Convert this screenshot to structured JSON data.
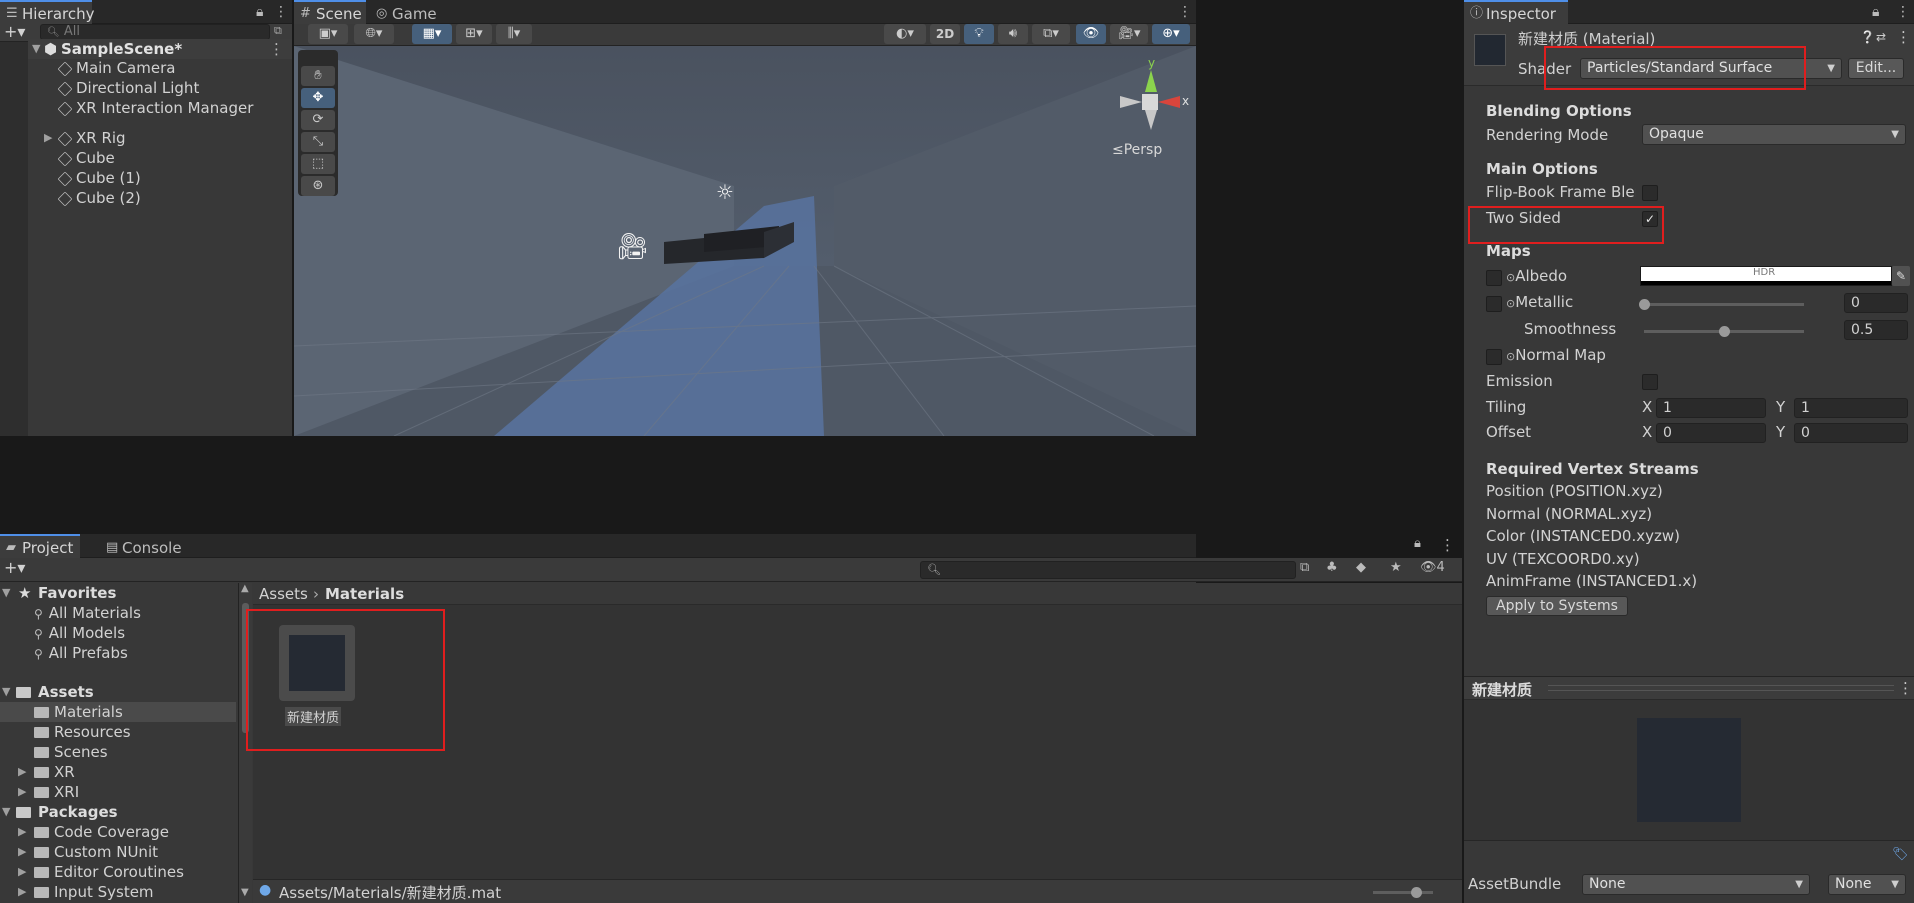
{
  "hierarchy": {
    "tab_label": "Hierarchy",
    "search_placeholder": "All",
    "scene_name": "SampleScene*",
    "items": [
      {
        "label": "Main Camera"
      },
      {
        "label": "Directional Light"
      },
      {
        "label": "XR Interaction Manager"
      },
      {
        "label": "XR Rig"
      },
      {
        "label": "Cube"
      },
      {
        "label": "Cube (1)"
      },
      {
        "label": "Cube (2)"
      }
    ]
  },
  "scene_view": {
    "tabs": [
      {
        "label": "Scene"
      },
      {
        "label": "Game"
      }
    ],
    "toggle_2d_label": "2D",
    "gizmo_y": "y",
    "gizmo_x": "x",
    "persp_label": "≤Persp"
  },
  "project": {
    "tabs": [
      {
        "label": "Project"
      },
      {
        "label": "Console"
      }
    ],
    "hidden_count": "4",
    "favorites": {
      "label": "Favorites",
      "items": [
        {
          "label": "All Materials"
        },
        {
          "label": "All Models"
        },
        {
          "label": "All Prefabs"
        }
      ]
    },
    "assets": {
      "label": "Assets",
      "items": [
        {
          "label": "Materials"
        },
        {
          "label": "Resources"
        },
        {
          "label": "Scenes"
        },
        {
          "label": "XR"
        },
        {
          "label": "XRI"
        }
      ]
    },
    "packages": {
      "label": "Packages",
      "items": [
        {
          "label": "Code Coverage"
        },
        {
          "label": "Custom NUnit"
        },
        {
          "label": "Editor Coroutines"
        },
        {
          "label": "Input System"
        }
      ]
    },
    "breadcrumb": {
      "root": "Assets",
      "current": "Materials"
    },
    "asset_items": [
      {
        "label": "新建材质"
      }
    ],
    "status_path": "Assets/Materials/新建材质.mat"
  },
  "inspector": {
    "tab_label": "Inspector",
    "title": "新建材质 (Material)",
    "shader_label": "Shader",
    "shader_value": "Particles/Standard Surface",
    "edit_button": "Edit...",
    "blending_header": "Blending Options",
    "rendering_mode_label": "Rendering Mode",
    "rendering_mode_value": "Opaque",
    "main_options_header": "Main Options",
    "flipbook_label": "Flip-Book Frame Blending",
    "two_sided_label": "Two Sided",
    "two_sided_checked": true,
    "maps_header": "Maps",
    "albedo_label": "Albedo",
    "albedo_hdr": "HDR",
    "metallic_label": "Metallic",
    "metallic_value": "0",
    "metallic_fraction": 0,
    "smoothness_label": "Smoothness",
    "smoothness_value": "0.5",
    "smoothness_fraction": 0.5,
    "normal_map_label": "Normal Map",
    "emission_label": "Emission",
    "tiling_label": "Tiling",
    "tiling_x": "1",
    "tiling_y": "1",
    "offset_label": "Offset",
    "offset_x": "0",
    "offset_y": "0",
    "axis_x": "X",
    "axis_y": "Y",
    "vertex_streams_header": "Required Vertex Streams",
    "vertex_streams": [
      {
        "label": "Position (POSITION.xyz)"
      },
      {
        "label": "Normal (NORMAL.xyz)"
      },
      {
        "label": "Color (INSTANCED0.xyzw)"
      },
      {
        "label": "UV (TEXCOORD0.xy)"
      },
      {
        "label": "AnimFrame (INSTANCED1.x)"
      }
    ],
    "apply_button": "Apply to Systems",
    "preview_title": "新建材质",
    "assetbundle_label": "AssetBundle",
    "assetbundle_value": "None",
    "assetbundle_variant": "None"
  },
  "colors": {
    "accent": "#4f8fe8",
    "highlight_box": "#e01e1e",
    "panel": "#383838",
    "material_swatch": "#252a33"
  }
}
